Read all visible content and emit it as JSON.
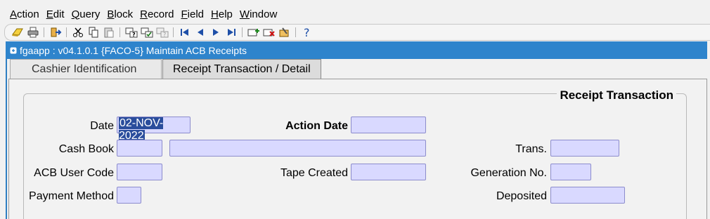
{
  "menu": [
    "Action",
    "Edit",
    "Query",
    "Block",
    "Record",
    "Field",
    "Help",
    "Window"
  ],
  "menu_mnemonic": [
    "A",
    "E",
    "Q",
    "B",
    "R",
    "F",
    "H",
    "W"
  ],
  "toolbar_icons": [
    "save-icon",
    "print-icon",
    "sep",
    "exit-icon",
    "sep",
    "cut-icon",
    "copy-icon",
    "paste-icon",
    "sep",
    "enter-query-icon",
    "execute-query-icon",
    "cancel-query-icon",
    "sep",
    "first-record-icon",
    "previous-record-icon",
    "next-record-icon",
    "last-record-icon",
    "sep",
    "insert-record-icon",
    "delete-record-icon",
    "clear-record-icon",
    "sep",
    "help-icon"
  ],
  "window": {
    "title": "fgaapp : v04.1.0.1  {FACO-5} Maintain ACB Receipts"
  },
  "tabs": [
    {
      "label": "Cashier Identification",
      "active": false
    },
    {
      "label": "Receipt Transaction / Detail",
      "active": true
    }
  ],
  "group": {
    "title": "Receipt Transaction"
  },
  "form": {
    "date_label": "Date",
    "date_value": "02-NOV-2022",
    "action_date_label": "Action Date",
    "action_date_value": "",
    "cash_book_label": "Cash Book",
    "cash_book_code": "",
    "cash_book_desc": "",
    "trans_label": "Trans.",
    "trans_value": "",
    "acb_user_code_label": "ACB User Code",
    "acb_user_code_value": "",
    "tape_created_label": "Tape Created",
    "tape_created_value": "",
    "generation_no_label": "Generation No.",
    "generation_no_value": "",
    "payment_method_label": "Payment Method",
    "payment_method_value": "",
    "deposited_label": "Deposited",
    "deposited_value": ""
  },
  "colors": {
    "titlebar": "#2e84cc",
    "field": "#d9d9ff",
    "selection": "#2a4d9c"
  }
}
